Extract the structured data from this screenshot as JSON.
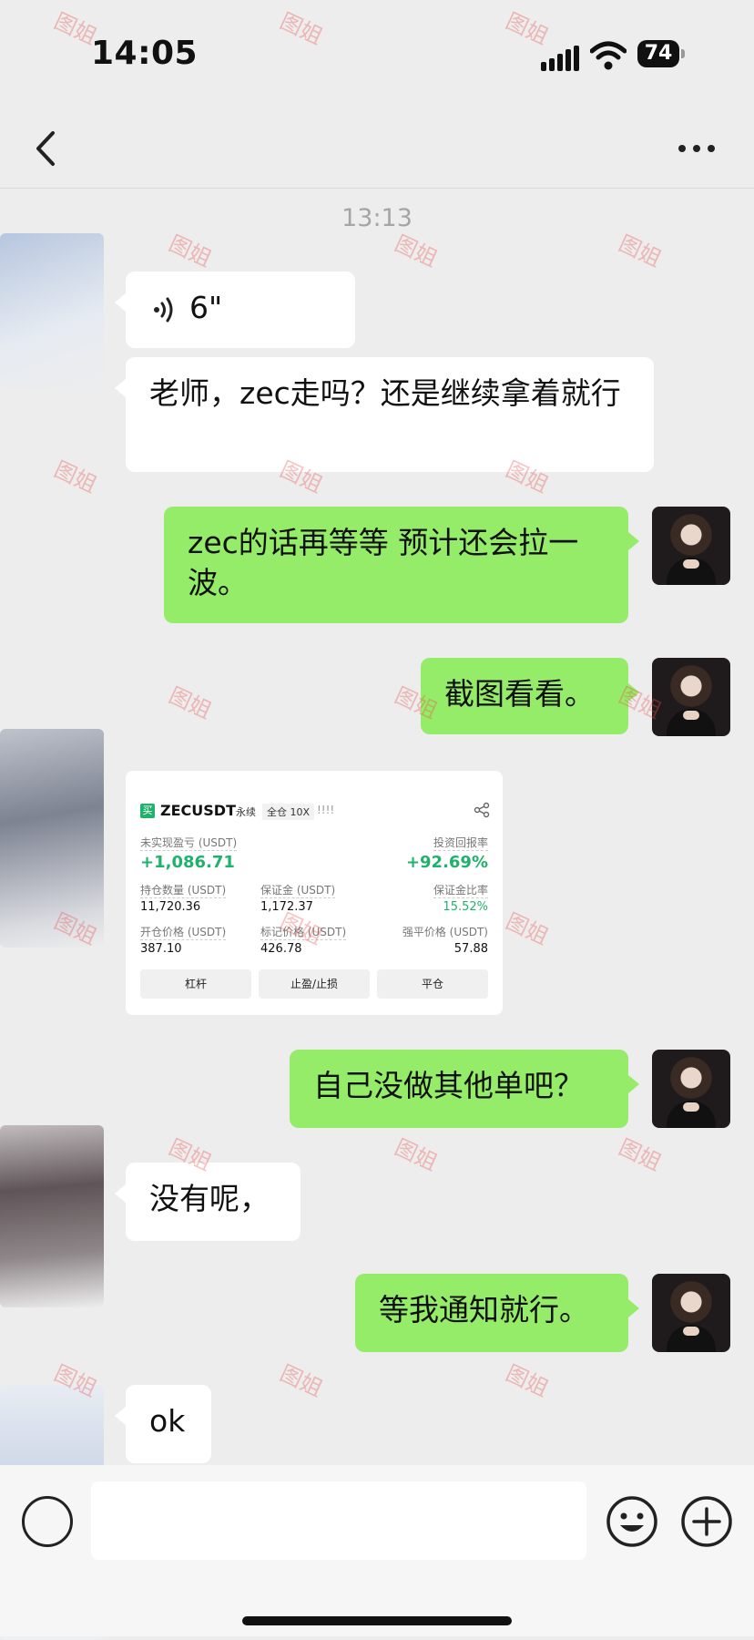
{
  "status": {
    "time": "14:05",
    "battery": "74"
  },
  "chat": {
    "timestamp": "13:13",
    "messages": {
      "voice": {
        "duration": "6\""
      },
      "m1": "老师，zec走吗？还是继续拿着就行",
      "m2": "zec的话再等等 预计还会拉一波。",
      "m3": "截图看看。",
      "m4": "自己没做其他单吧？",
      "m5": "没有呢，",
      "m6": "等我通知就行。",
      "m7": "ok"
    }
  },
  "trade_card": {
    "side": "买",
    "symbol": "ZECUSDT",
    "contract_type": "永续",
    "margin_mode": "全仓 10X",
    "leverage_bars": "!!!!",
    "unrealized_pnl_label": "未实现盈亏 (USDT)",
    "unrealized_pnl": "+1,086.71",
    "roi_label": "投资回报率",
    "roi": "+92.69%",
    "position_size_label": "持仓数量 (USDT)",
    "position_size": "11,720.36",
    "margin_label": "保证金 (USDT)",
    "margin": "1,172.37",
    "margin_ratio_label": "保证金比率",
    "margin_ratio": "15.52%",
    "entry_price_label": "开仓价格 (USDT)",
    "entry_price": "387.10",
    "mark_price_label": "标记价格 (USDT)",
    "mark_price": "426.78",
    "liq_price_label": "强平价格 (USDT)",
    "liq_price": "57.88",
    "buttons": {
      "leverage": "杠杆",
      "tp_sl": "止盈/止损",
      "close": "平仓"
    }
  },
  "watermark": "图姐",
  "colors": {
    "sent_bubble": "#95ec69",
    "received_bubble": "#ffffff",
    "profit_green": "#20b26c",
    "background": "#ededed"
  },
  "icons": [
    "back-icon",
    "more-icon",
    "voice-icon",
    "share-icon",
    "emoji-icon",
    "plus-icon",
    "voice-toggle-icon"
  ]
}
